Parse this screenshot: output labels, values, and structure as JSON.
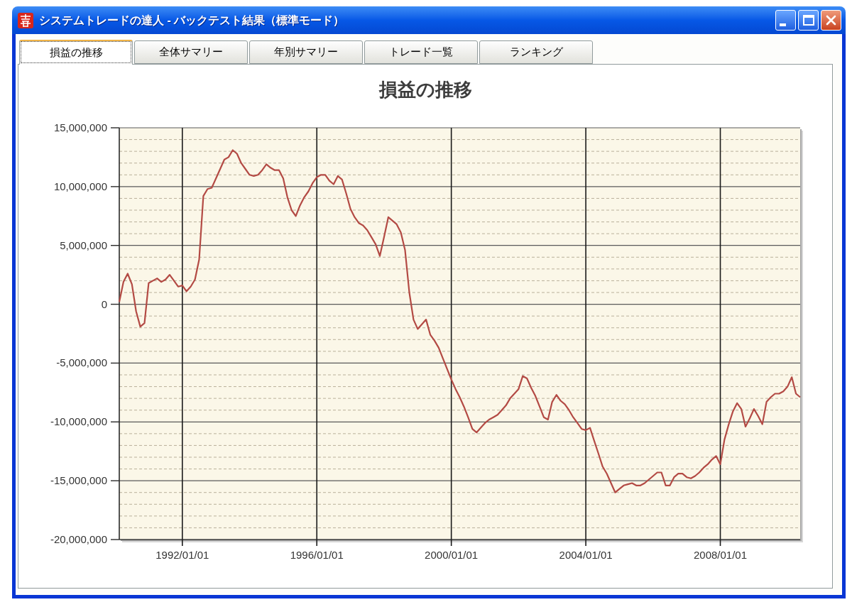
{
  "window": {
    "title": "システムトレードの達人 - バックテスト結果（標準モード）"
  },
  "tabs": [
    {
      "label": "損益の推移",
      "selected": true
    },
    {
      "label": "全体サマリー",
      "selected": false
    },
    {
      "label": "年別サマリー",
      "selected": false
    },
    {
      "label": "トレード一覧",
      "selected": false
    },
    {
      "label": "ランキング",
      "selected": false
    }
  ],
  "chart": {
    "chart_data": {
      "type": "line",
      "title": "損益の推移",
      "grid": true,
      "ylim": [
        -20000000,
        15000000
      ],
      "yticks": [
        {
          "value": 15000000,
          "label": "15,000,000"
        },
        {
          "value": 10000000,
          "label": "10,000,000"
        },
        {
          "value": 5000000,
          "label": "5,000,000"
        },
        {
          "value": 0,
          "label": "0"
        },
        {
          "value": -5000000,
          "label": "-5,000,000"
        },
        {
          "value": -10000000,
          "label": "-10,000,000"
        },
        {
          "value": -15000000,
          "label": "-15,000,000"
        },
        {
          "value": -20000000,
          "label": "-20,000,000"
        }
      ],
      "categories": [
        null,
        null,
        null,
        null,
        null,
        null,
        null,
        null,
        null,
        null,
        null,
        null,
        null,
        null,
        null,
        "1992/01/01",
        null,
        null,
        null,
        null,
        null,
        null,
        null,
        null,
        null,
        null,
        null,
        null,
        null,
        null,
        null,
        null,
        null,
        null,
        null,
        null,
        null,
        null,
        null,
        null,
        null,
        null,
        null,
        null,
        null,
        null,
        null,
        "1996/01/01",
        null,
        null,
        null,
        null,
        null,
        null,
        null,
        null,
        null,
        null,
        null,
        null,
        null,
        null,
        null,
        null,
        null,
        null,
        null,
        null,
        null,
        null,
        null,
        null,
        null,
        null,
        null,
        null,
        null,
        null,
        null,
        "2000/01/01",
        null,
        null,
        null,
        null,
        null,
        null,
        null,
        null,
        null,
        null,
        null,
        null,
        null,
        null,
        null,
        null,
        null,
        null,
        null,
        null,
        null,
        null,
        null,
        null,
        null,
        null,
        null,
        null,
        null,
        null,
        null,
        "2004/01/01",
        null,
        null,
        null,
        null,
        null,
        null,
        null,
        null,
        null,
        null,
        null,
        null,
        null,
        null,
        null,
        null,
        null,
        null,
        null,
        null,
        null,
        null,
        null,
        null,
        null,
        null,
        null,
        null,
        null,
        null,
        null,
        "2008/01/01",
        null,
        null,
        null,
        null,
        null,
        null,
        null,
        null,
        null,
        null,
        null,
        null,
        null,
        null,
        null,
        null,
        null,
        null,
        null
      ],
      "series": [
        {
          "color": "#b34a44",
          "values": [
            200000,
            1900000,
            2600000,
            1700000,
            -600000,
            -1900000,
            -1600000,
            1800000,
            2000000,
            2200000,
            1900000,
            2100000,
            2500000,
            2000000,
            1500000,
            1600000,
            1100000,
            1500000,
            2100000,
            3800000,
            9200000,
            9800000,
            9900000,
            10700000,
            11500000,
            12300000,
            12500000,
            13100000,
            12800000,
            12000000,
            11500000,
            11000000,
            10900000,
            11000000,
            11400000,
            11900000,
            11600000,
            11400000,
            11400000,
            10700000,
            9100000,
            8000000,
            7500000,
            8400000,
            9100000,
            9600000,
            10300000,
            10800000,
            11000000,
            11000000,
            10500000,
            10200000,
            10900000,
            10600000,
            9400000,
            8100000,
            7400000,
            6900000,
            6700000,
            6300000,
            5700000,
            5100000,
            4100000,
            5700000,
            7400000,
            7100000,
            6800000,
            6100000,
            4600000,
            1000000,
            -1300000,
            -2100000,
            -1700000,
            -1300000,
            -2600000,
            -3100000,
            -3700000,
            -4600000,
            -5500000,
            -6400000,
            -7200000,
            -7900000,
            -8700000,
            -9600000,
            -10600000,
            -10900000,
            -10500000,
            -10100000,
            -9800000,
            -9600000,
            -9400000,
            -9000000,
            -8600000,
            -8000000,
            -7600000,
            -7200000,
            -6100000,
            -6300000,
            -7100000,
            -7800000,
            -8700000,
            -9600000,
            -9800000,
            -8300000,
            -7700000,
            -8200000,
            -8500000,
            -9000000,
            -9600000,
            -10100000,
            -10600000,
            -10700000,
            -10500000,
            -11600000,
            -12700000,
            -13800000,
            -14400000,
            -15200000,
            -16000000,
            -15700000,
            -15400000,
            -15300000,
            -15200000,
            -15400000,
            -15400000,
            -15200000,
            -14900000,
            -14600000,
            -14300000,
            -14300000,
            -15400000,
            -15400000,
            -14700000,
            -14400000,
            -14400000,
            -14700000,
            -14800000,
            -14600000,
            -14300000,
            -13900000,
            -13600000,
            -13200000,
            -12900000,
            -13600000,
            -11500000,
            -10200000,
            -9100000,
            -8400000,
            -8900000,
            -10400000,
            -9700000,
            -8900000,
            -9500000,
            -10200000,
            -8300000,
            -7900000,
            -7600000,
            -7600000,
            -7400000,
            -7000000,
            -6200000,
            -7600000,
            -7900000
          ]
        }
      ]
    }
  }
}
